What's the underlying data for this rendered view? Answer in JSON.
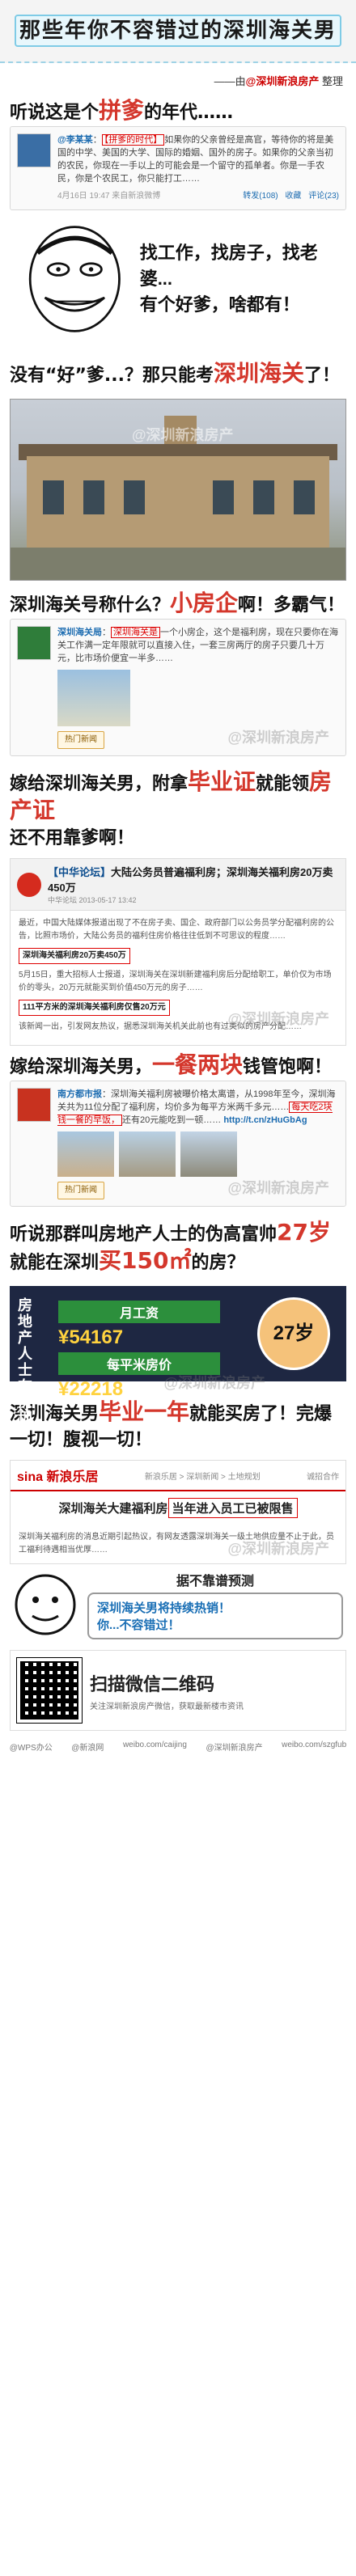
{
  "banner": {
    "title": "那些年你不容错过的深圳海关男"
  },
  "credit": {
    "prefix": "——由",
    "brand": "@深圳新浪房产",
    "suffix": "整理"
  },
  "s1": {
    "heading_pre": "听说这是个",
    "heading_hl": "拼爹",
    "heading_post": "的年代……",
    "weibo_name": "@李某某",
    "weibo_text_pre": "：",
    "weibo_boxed": "【拼爹的时代】",
    "weibo_text": "如果你的父亲曾经是高官，等待你的将是美国的中学、美国的大学、国际的婚姻、国外的房子。如果你的父亲当初的农民，你现在一手以上的可能会是一个留守的孤单者。你是一手农民，你是个农民工，你只能打工……",
    "time": "4月16日 19:47",
    "source": "来自新浪微博",
    "actions": [
      "转发(108)",
      "收藏",
      "评论(23)"
    ],
    "comic_line1": "找工作，找房子，找老婆...",
    "comic_line2": "有个好爹，啥都有！"
  },
  "s2": {
    "heading_pre": "没有“好”爹...？那只能考",
    "heading_hl": "深圳海关",
    "heading_post": "了！",
    "watermark": "@深圳新浪房产"
  },
  "s3": {
    "heading_pre": "深圳海关号称什么？",
    "heading_hl": "小房企",
    "heading_post": "啊！多霸气！",
    "weibo_name": "深圳海关局",
    "weibo_boxed": "深圳海关是",
    "weibo_text": "一个小房企，这个是福利房，现在只要你在海关工作满一定年限就可以直接入住，一套三房两厅的房子只要几十万元，比市场价便宜一半多……",
    "btn": "热门新闻",
    "watermark": "@深圳新浪房产"
  },
  "s4": {
    "heading_pre": "嫁给深圳海关男，附拿",
    "heading_hl": "毕业证",
    "heading_mid": "就能领",
    "heading_hl2": "房产证",
    "heading_post": "还不用靠爹啊！",
    "news_brand": "【中华论坛】",
    "news_title": "大陆公务员普遍福利房；深圳海关福利房20万卖450万",
    "news_meta": "中华论坛 2013-05-17 13:42",
    "boxed1": "深圳海关福利房20万卖450万",
    "para1": "最近，中国大陆媒体报道出现了不在房子卖、国企、政府部门以公务员学分配福利房的公告，比照市场价，大陆公务员的福利住房价格往往低到不可思议的程度……",
    "para2": "5月15日，重大招标人士报道，深圳海关在深圳新建福利房后分配给职工，单价仅为市场价的零头，20万元就能买到价值450万元的房子……",
    "boxed2": "111平方米的深圳海关福利房仅售20万元",
    "para3": "该新闻一出，引发网友热议，据悉深圳海关机关此前也有过类似的房产分配……",
    "watermark": "@深圳新浪房产"
  },
  "s5": {
    "heading_pre": "嫁给深圳海关男，",
    "heading_hl": "一餐两块",
    "heading_post": "钱管饱啊！",
    "weibo_name": "南方都市报",
    "weibo_text": "深圳海关福利房被曝价格太离谱，从1998年至今，深圳海关共为11位分配了福利房，均价多为每平方米两千多元……",
    "weibo_boxed": "每天吃2块钱一餐的早饭，",
    "weibo_text2": "还有20元能吃到一顿……",
    "link": "http://t.cn/zHuGbAg",
    "btn": "热门新闻",
    "watermark": "@深圳新浪房产"
  },
  "s6": {
    "heading_pre": "听说那群叫房地产人士的伪高富帅",
    "heading_hl": "27岁",
    "heading_mid": "就能在深圳",
    "heading_hl2": "买150㎡",
    "heading_post": "的房？",
    "poster_side": "房地产人士在深圳",
    "salary_label": "月工资",
    "salary_value": "¥54167",
    "price_label": "每平米房价",
    "price_value": "¥22218",
    "age": "27岁",
    "watermark": "@深圳新浪房产"
  },
  "s7": {
    "heading_pre": "深圳海关男",
    "heading_hl": "毕业一年",
    "heading_post": "就能买房了！完爆一切！腹视一切！",
    "sina_logo": "sina 新浪乐居",
    "sina_nav": "新浪乐居 > 深圳新闻 > 土地规划",
    "sina_right": "诚招合作",
    "sina_title_pre": "深圳海关大建福利房",
    "sina_boxed": "当年进入员工已被限售",
    "sina_desc": "深圳海关福利房的消息近期引起热议，有网友透露深圳海关一级土地供应量不止于此，员工福利待遇相当优厚……",
    "watermark": "@深圳新浪房产"
  },
  "predict": {
    "head": "据不靠谱预测",
    "line1": "深圳海关男将持续热销！",
    "line2": "你...不容错过！"
  },
  "qr": {
    "title": "扫描微信二维码",
    "sub": "关注深圳新浪房产微信，获取最新楼市资讯"
  },
  "footer": [
    "@新浪网",
    "weibo.com/caijing",
    "@深圳新浪房产",
    "weibo.com/szgfub"
  ],
  "footer_left": "@WPS办公"
}
